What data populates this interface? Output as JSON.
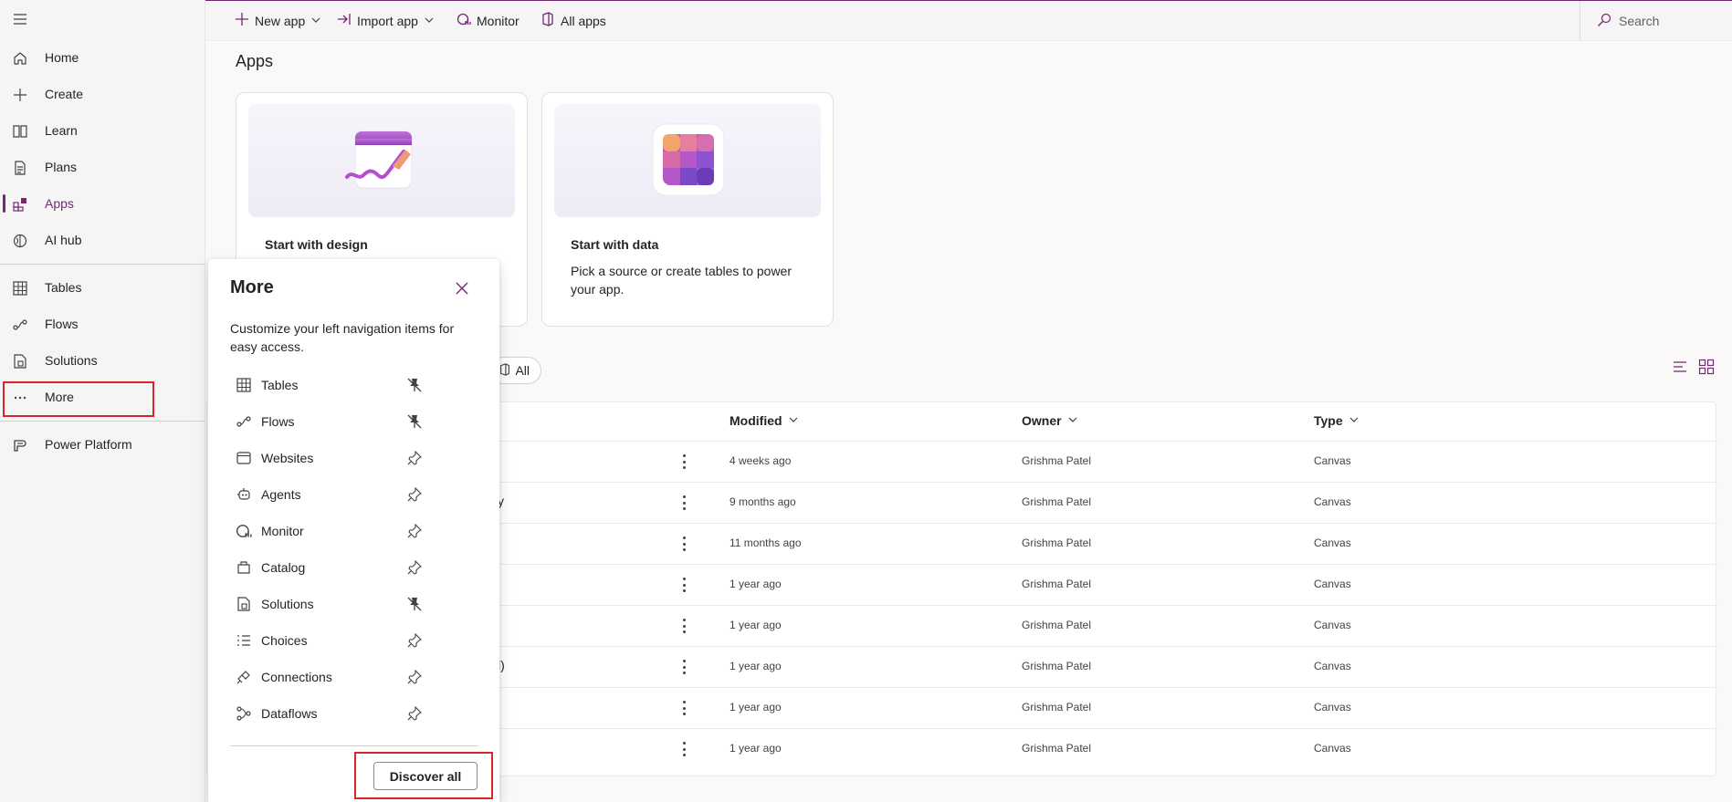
{
  "sidebar": {
    "items": [
      {
        "label": "Home",
        "icon": "home-icon"
      },
      {
        "label": "Create",
        "icon": "plus-icon"
      },
      {
        "label": "Learn",
        "icon": "book-icon"
      },
      {
        "label": "Plans",
        "icon": "plans-icon"
      },
      {
        "label": "Apps",
        "icon": "apps-icon",
        "active": true
      },
      {
        "label": "AI hub",
        "icon": "ai-hub-icon"
      },
      {
        "label": "Tables",
        "icon": "table-icon"
      },
      {
        "label": "Flows",
        "icon": "flow-icon"
      },
      {
        "label": "Solutions",
        "icon": "solutions-icon"
      },
      {
        "label": "More",
        "icon": "ellipsis-icon"
      },
      {
        "label": "Power Platform",
        "icon": "power-platform-icon"
      }
    ]
  },
  "commandbar": {
    "new_app": "New app",
    "import_app": "Import app",
    "monitor": "Monitor",
    "all_apps": "All apps",
    "search_placeholder": "Search"
  },
  "main": {
    "title": "Apps",
    "cards": [
      {
        "title": "Start with design",
        "desc": ""
      },
      {
        "title": "Start with data",
        "desc": "Pick a source or create tables to power your app."
      }
    ],
    "filter_all": "All"
  },
  "table": {
    "headers": {
      "modified": "Modified",
      "owner": "Owner",
      "type": "Type"
    },
    "rows": [
      {
        "name_fragment": "",
        "modified": "4 weeks ago",
        "owner": "Grishma Patel",
        "type": "Canvas"
      },
      {
        "name_fragment": "y",
        "modified": "9 months ago",
        "owner": "Grishma Patel",
        "type": "Canvas"
      },
      {
        "name_fragment": "",
        "modified": "11 months ago",
        "owner": "Grishma Patel",
        "type": "Canvas"
      },
      {
        "name_fragment": "",
        "modified": "1 year ago",
        "owner": "Grishma Patel",
        "type": "Canvas"
      },
      {
        "name_fragment": "",
        "modified": "1 year ago",
        "owner": "Grishma Patel",
        "type": "Canvas"
      },
      {
        "name_fragment": "l)",
        "modified": "1 year ago",
        "owner": "Grishma Patel",
        "type": "Canvas"
      },
      {
        "name_fragment": "",
        "modified": "1 year ago",
        "owner": "Grishma Patel",
        "type": "Canvas"
      },
      {
        "name_fragment": "",
        "modified": "1 year ago",
        "owner": "Grishma Patel",
        "type": "Canvas"
      }
    ]
  },
  "more_panel": {
    "title": "More",
    "description": "Customize your left navigation items for easy access.",
    "items": [
      {
        "label": "Tables",
        "icon": "table-icon",
        "pinned": true
      },
      {
        "label": "Flows",
        "icon": "flow-icon",
        "pinned": true
      },
      {
        "label": "Websites",
        "icon": "website-icon",
        "pinned": false
      },
      {
        "label": "Agents",
        "icon": "agent-icon",
        "pinned": false
      },
      {
        "label": "Monitor",
        "icon": "monitor-icon",
        "pinned": false
      },
      {
        "label": "Catalog",
        "icon": "catalog-icon",
        "pinned": false
      },
      {
        "label": "Solutions",
        "icon": "solutions-icon",
        "pinned": true
      },
      {
        "label": "Choices",
        "icon": "choices-icon",
        "pinned": false
      },
      {
        "label": "Connections",
        "icon": "connections-icon",
        "pinned": false
      },
      {
        "label": "Dataflows",
        "icon": "dataflows-icon",
        "pinned": false
      }
    ],
    "discover_all": "Discover all"
  },
  "colors": {
    "accent": "#742774",
    "highlight": "#d9232d"
  }
}
